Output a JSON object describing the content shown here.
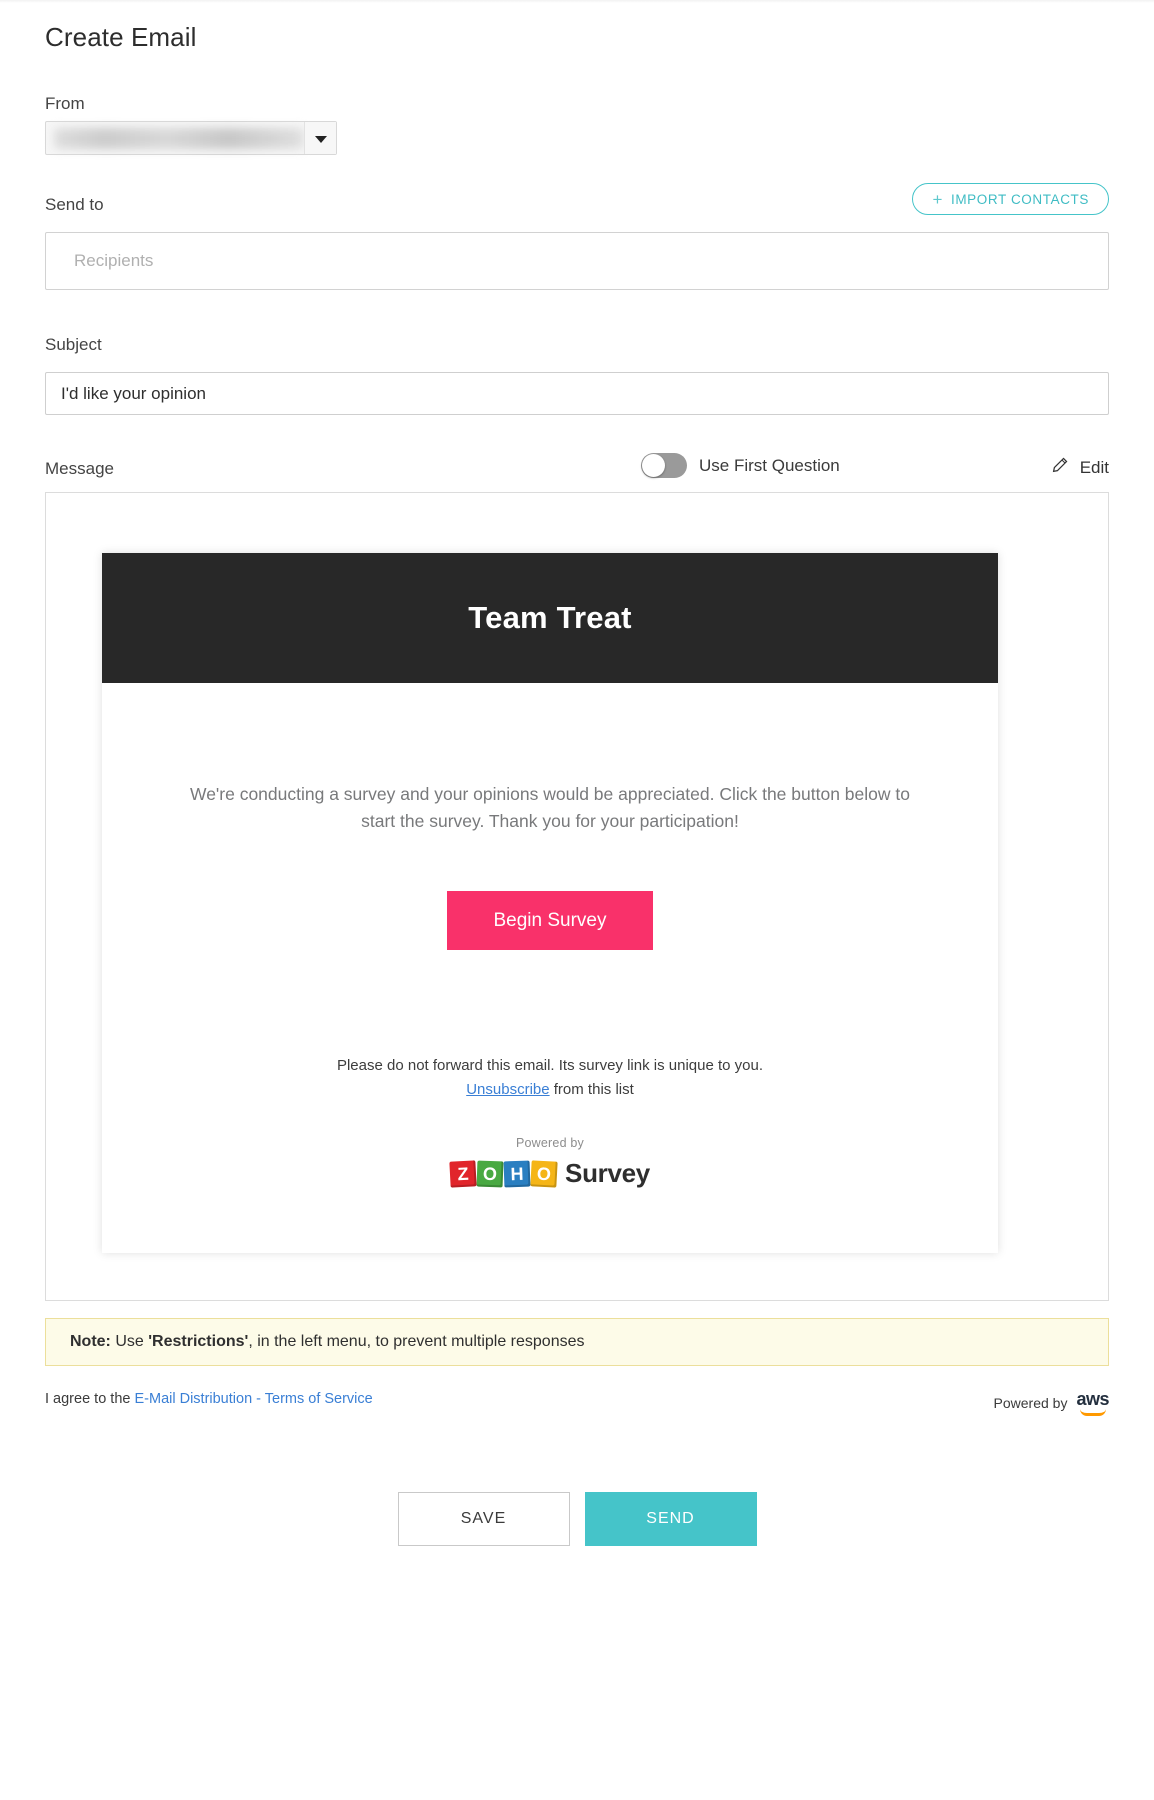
{
  "page": {
    "title": "Create Email"
  },
  "from": {
    "label": "From",
    "value": "",
    "caret_icon": "chevron-down-icon"
  },
  "send_to": {
    "label": "Send to",
    "import_button": {
      "label": "IMPORT CONTACTS",
      "plus": "+"
    },
    "placeholder": "Recipients",
    "value": ""
  },
  "subject": {
    "label": "Subject",
    "value": "I'd like your opinion"
  },
  "message": {
    "label": "Message",
    "toggle_label": "Use First Question",
    "toggle_state": "off",
    "edit_label": "Edit",
    "edit_icon": "pencil-icon"
  },
  "email_preview": {
    "banner_title": "Team Treat",
    "banner_color": "#282828",
    "intro": "We're conducting a survey and your opinions would be appreciated. Click the button below to start the survey. Thank you for your participation!",
    "cta_label": "Begin Survey",
    "cta_color": "#f9316a",
    "footer_note": "Please do not forward this email. Its survey link is unique to you.",
    "unsubscribe_link": "Unsubscribe",
    "unsubscribe_suffix": " from this list",
    "powered_by": "Powered by",
    "brand_blocks": [
      "Z",
      "O",
      "H",
      "O"
    ],
    "brand_word": "Survey"
  },
  "note": {
    "prefix": "Note:",
    "text_before": " Use ",
    "emphasis": "'Restrictions'",
    "text_after": ", in the left menu, to prevent multiple responses"
  },
  "terms": {
    "text": "I agree to the ",
    "link": "E-Mail Distribution - Terms of Service"
  },
  "aws": {
    "powered_by": "Powered by",
    "word": "aws"
  },
  "footer": {
    "save_label": "SAVE",
    "send_label": "SEND",
    "send_color": "#45c4c9"
  }
}
